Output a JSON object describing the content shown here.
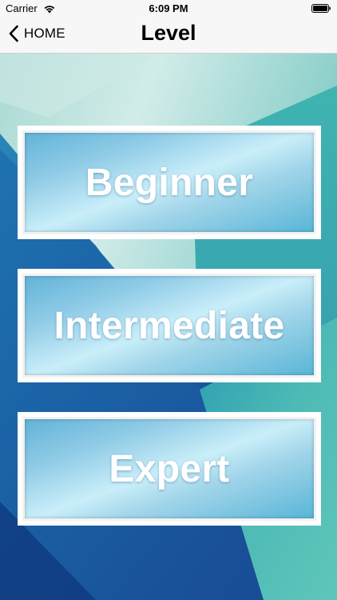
{
  "status_bar": {
    "carrier": "Carrier",
    "time": "6:09 PM"
  },
  "nav": {
    "back_label": "HOME",
    "title": "Level"
  },
  "levels": [
    {
      "label": "Beginner"
    },
    {
      "label": "Intermediate"
    },
    {
      "label": "Expert"
    }
  ],
  "colors": {
    "bar_background": "#f7f7f7",
    "button_frame": "#ffffff",
    "label_text": "#ffffff",
    "bg_teal": "#4fbfb4",
    "bg_blue": "#1a5aa8"
  },
  "icons": {
    "wifi": "wifi-icon",
    "battery": "battery-icon",
    "back": "chevron-left-icon"
  }
}
